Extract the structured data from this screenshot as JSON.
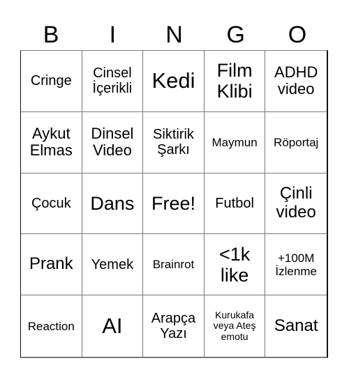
{
  "header": [
    "B",
    "I",
    "N",
    "G",
    "O"
  ],
  "cells": [
    [
      "Cringe",
      "Cinsel İçerikli",
      "Kedi",
      "Film Klibi",
      "ADHD video"
    ],
    [
      "Aykut Elmas",
      "Dinsel Video",
      "Siktirik Şarkı",
      "Maymun",
      "Röportaj"
    ],
    [
      "Çocuk",
      "Dans",
      "Free!",
      "Futbol",
      "Çinli video"
    ],
    [
      "Prank",
      "Yemek",
      "Brainrot",
      "<1k like",
      "+100M İzlenme"
    ],
    [
      "Reaction",
      "AI",
      "Arapça Yazı",
      "Kurukafa veya Ateş emotu",
      "Sanat"
    ]
  ]
}
